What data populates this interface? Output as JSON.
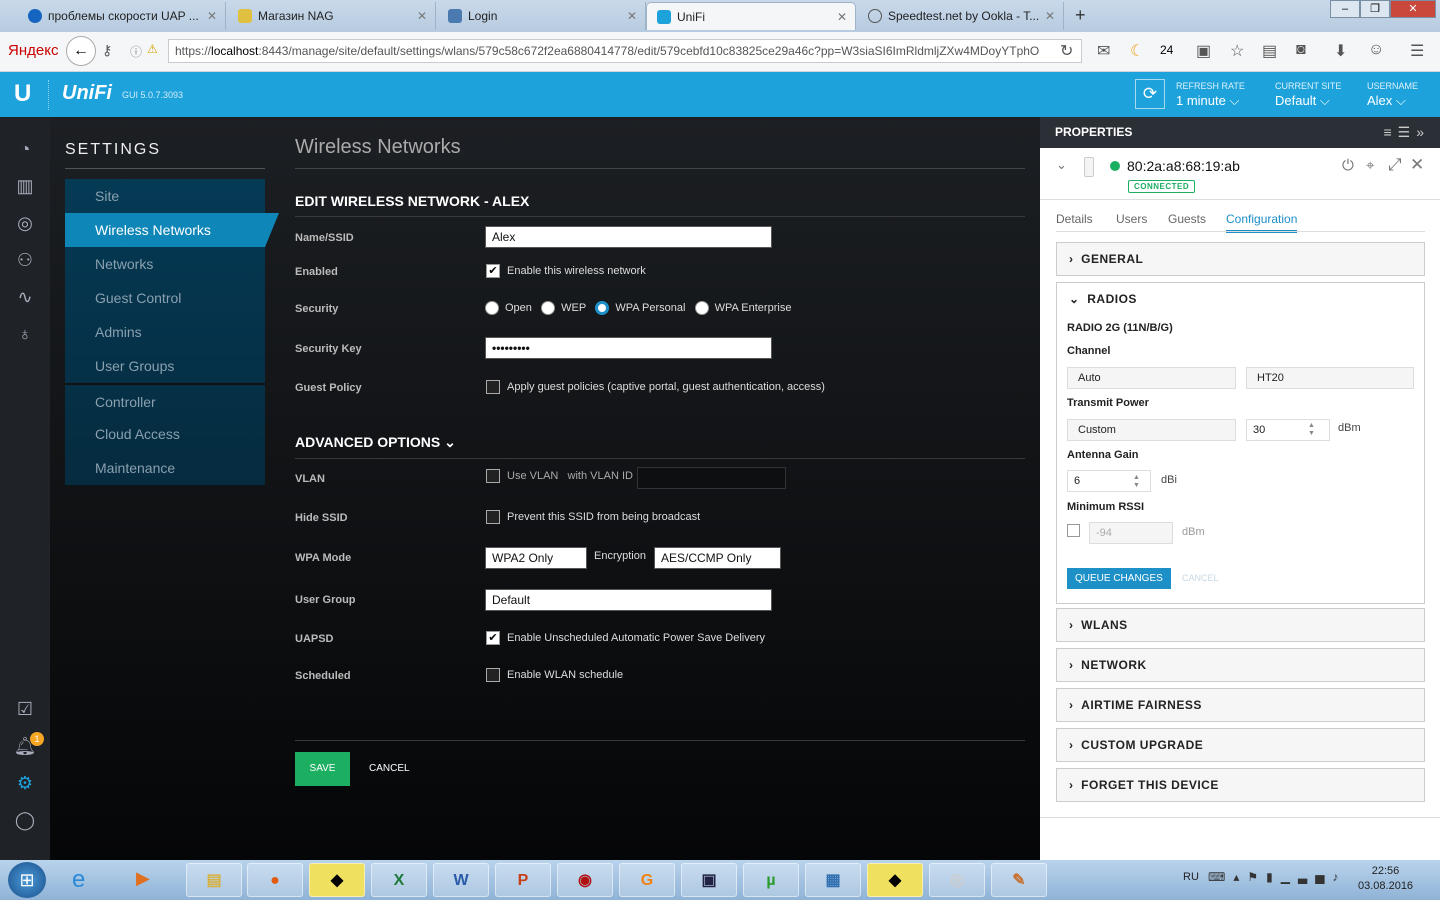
{
  "browser": {
    "tabs": [
      {
        "label": "проблемы скорости UAP ...",
        "color": "#1565c0"
      },
      {
        "label": "Магазин NAG",
        "color": "#e0c040"
      },
      {
        "label": "Login",
        "color": "#4a7ab0"
      },
      {
        "label": "UniFi",
        "color": "#1ea2dc"
      },
      {
        "label": "Speedtest.net by Ookla - T...",
        "color": "#555"
      }
    ],
    "new_tab": "+",
    "yandex": "Яндекс",
    "url_prefix": "https://",
    "url_host": "localhost",
    "url_rest": ":8443/manage/site/default/settings/wlans/579c58c672f2ea6880414778/edit/579cebfd10c83825ce29a46c?pp=W3siaSI6ImRldmljZXw4MDoyYTphO",
    "weather": "24"
  },
  "header": {
    "logo": "U",
    "brand": "UniFi",
    "version": "GUI 5.0.7.3093",
    "refresh_label": "REFRESH RATE",
    "refresh_value": "1 minute",
    "site_label": "CURRENT SITE",
    "site_value": "Default",
    "user_label": "USERNAME",
    "user_value": "Alex"
  },
  "nav": {
    "alert_count": "1"
  },
  "settings": {
    "title": "SETTINGS",
    "items": [
      "Site",
      "Wireless Networks",
      "Networks",
      "Guest Control",
      "Admins",
      "User Groups",
      "Controller",
      "Cloud Access",
      "Maintenance"
    ]
  },
  "form": {
    "page_title": "Wireless Networks",
    "section": "EDIT WIRELESS NETWORK - ALEX",
    "labels": {
      "ssid": "Name/SSID",
      "enabled": "Enabled",
      "security": "Security",
      "key": "Security Key",
      "guest": "Guest Policy",
      "vlan": "VLAN",
      "hide": "Hide SSID",
      "wpa": "WPA Mode",
      "group": "User Group",
      "uapsd": "UAPSD",
      "scheduled": "Scheduled"
    },
    "ssid": "Alex",
    "enabled_text": "Enable this wireless network",
    "security_options": [
      "Open",
      "WEP",
      "WPA Personal",
      "WPA Enterprise"
    ],
    "key": "•••••••••",
    "guest_text": "Apply guest policies (captive portal, guest authentication, access)",
    "advanced": "ADVANCED OPTIONS",
    "vlan_text": "Use VLAN",
    "vlan_id_text": "with VLAN ID",
    "hide_text": "Prevent this SSID from being broadcast",
    "wpa_mode": "WPA2 Only",
    "encryption_label": "Encryption",
    "encryption": "AES/CCMP Only",
    "user_group": "Default",
    "uapsd_text": "Enable Unscheduled Automatic Power Save Delivery",
    "sched_text": "Enable WLAN schedule",
    "save": "SAVE",
    "cancel": "CANCEL"
  },
  "properties": {
    "title": "PROPERTIES",
    "mac": "80:2a:a8:68:19:ab",
    "status": "CONNECTED",
    "tabs": [
      "Details",
      "Users",
      "Guests",
      "Configuration"
    ],
    "general": "GENERAL",
    "radios": "RADIOS",
    "radio_name": "RADIO 2G (11N/B/G)",
    "channel_label": "Channel",
    "channel": "Auto",
    "width": "HT20",
    "tx_label": "Transmit Power",
    "tx_mode": "Custom",
    "tx_value": "30",
    "dbm": "dBm",
    "gain_label": "Antenna Gain",
    "gain": "6",
    "dbi": "dBi",
    "rssi_label": "Minimum RSSI",
    "rssi": "-94",
    "queue": "QUEUE CHANGES",
    "cancel": "CANCEL",
    "sections": [
      "WLANS",
      "NETWORK",
      "AIRTIME FAIRNESS",
      "CUSTOM UPGRADE",
      "FORGET THIS DEVICE"
    ]
  },
  "taskbar": {
    "lang": "RU",
    "time": "22:56",
    "date": "03.08.2016"
  }
}
